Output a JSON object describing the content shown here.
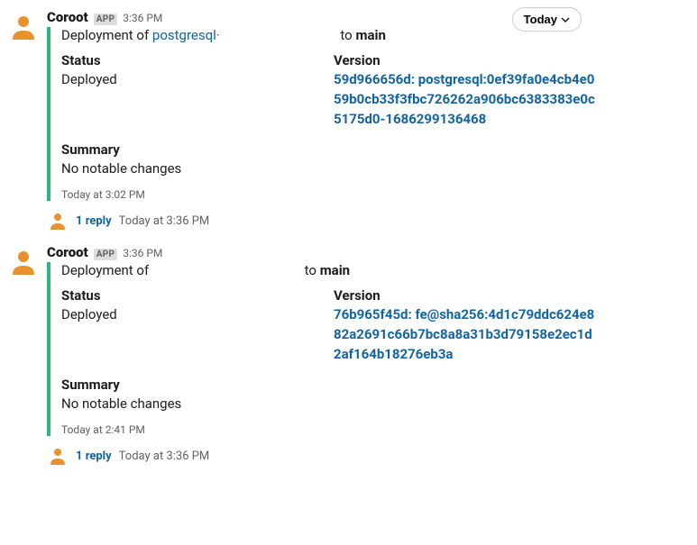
{
  "todayButton": "Today",
  "messages": [
    {
      "sender": "Coroot",
      "badge": "APP",
      "timestamp": "3:36 PM",
      "attachment": {
        "title_pre": "Deployment of ",
        "title_link": "postgresql·",
        "title_mid": " to ",
        "title_bold": "main",
        "status_label": "Status",
        "status_value": "Deployed",
        "version_label": "Version",
        "version_value": "59d966656d: postgresql:0ef39fa0e4cb4e059b0cb33f3fbc726262a906bc6383383e0c5175d0-1686299136468",
        "summary_label": "Summary",
        "summary_value": "No notable changes",
        "footer": "Today at 3:02 PM"
      },
      "thread": {
        "reply_text": "1 reply",
        "ts": "Today at 3:36 PM"
      }
    },
    {
      "sender": "Coroot",
      "badge": "APP",
      "timestamp": "3:36 PM",
      "attachment": {
        "title_pre": "Deployment of ",
        "title_link": "",
        "title_mid": " to ",
        "title_bold": "main",
        "status_label": "Status",
        "status_value": "Deployed",
        "version_label": "Version",
        "version_value": "76b965f45d: fe@sha256:4d1c79ddc624e882a2691c66b7bc8a8a31b3d79158e2ec1d2af164b18276eb3a",
        "summary_label": "Summary",
        "summary_value": "No notable changes",
        "footer": "Today at 2:41 PM"
      },
      "thread": {
        "reply_text": "1 reply",
        "ts": "Today at 3:36 PM"
      }
    }
  ]
}
